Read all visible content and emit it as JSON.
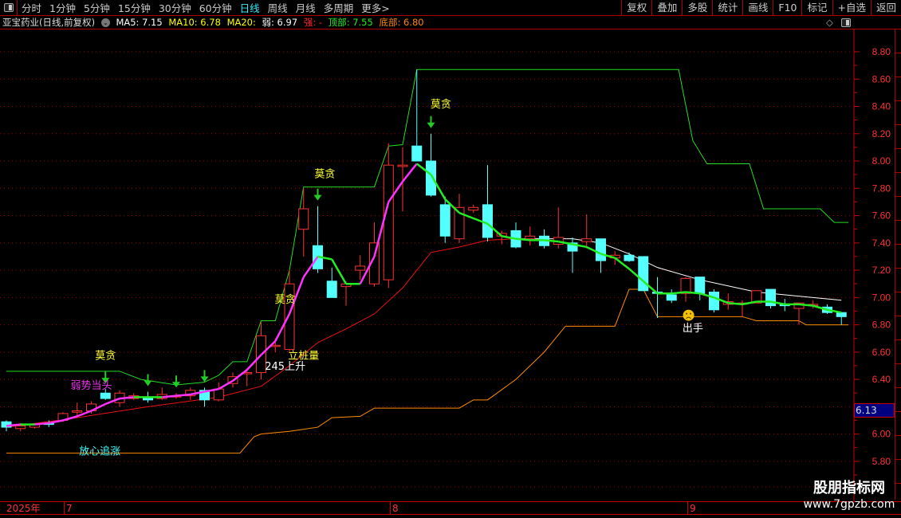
{
  "toolbar": {
    "timeframes": [
      "分时",
      "1分钟",
      "5分钟",
      "15分钟",
      "30分钟",
      "60分钟",
      "日线",
      "周线",
      "月线",
      "多周期",
      "更多>"
    ],
    "active": "日线",
    "right_buttons": [
      "复权",
      "叠加",
      "多股",
      "统计",
      "画线",
      "F10",
      "标记",
      "+自选",
      "返回"
    ]
  },
  "info": {
    "title": "亚宝药业(日线,前复权)",
    "ma5": "MA5: 7.15",
    "ma10": "MA10: 6.78",
    "ma20": "MA20:",
    "weak": "弱: 6.97",
    "strong": "强: -",
    "top": "顶部: 7.55",
    "bottom": "底部: 6.80"
  },
  "colors": {
    "up": "#ff3232",
    "down": "#54ffff",
    "upper": "#22dd22",
    "lower": "#ff8c00",
    "ma_up": "#ff33ff",
    "ma_down": "#22ee22",
    "ma_long": "#ee1111",
    "ma_white": "#ffffff",
    "grid": "#a00000",
    "axis": "#ff3333"
  },
  "axis": {
    "ticks": [
      "8.80",
      "8.60",
      "8.40",
      "8.20",
      "8.00",
      "7.80",
      "7.60",
      "7.40",
      "7.20",
      "7.00",
      "6.80",
      "6.60",
      "6.40",
      "6.20",
      "6.00",
      "5.80"
    ],
    "current_price": "6.13"
  },
  "dates": {
    "year": "2025年",
    "months": [
      "7",
      "8",
      "9"
    ]
  },
  "annotations": [
    {
      "text": "莫贪",
      "color": "#ffff33",
      "idx": 7,
      "price": 6.55
    },
    {
      "text": "莫贪",
      "color": "#ffff33",
      "idx": 22.5,
      "price": 7.88
    },
    {
      "text": "莫贪",
      "color": "#ffff33",
      "idx": 19.7,
      "price": 6.96
    },
    {
      "text": "莫贪",
      "color": "#ffff33",
      "idx": 30.7,
      "price": 8.39
    },
    {
      "text": "弱势当头",
      "color": "#ee33ee",
      "idx": 6,
      "price": 6.33
    },
    {
      "text": "放心追涨",
      "color": "#44ffff",
      "idx": 6.6,
      "price": 5.85
    },
    {
      "text": "立桩量",
      "color": "#ffff33",
      "idx": 21,
      "price": 6.55
    },
    {
      "text": "245上升",
      "color": "#ffffff",
      "idx": 19.7,
      "price": 6.47
    },
    {
      "text": "出手",
      "color": "#ffffff",
      "idx": 48.5,
      "price": 6.75
    }
  ],
  "logo": {
    "name": "股朋指标网",
    "url": "www.7gpzb.com"
  },
  "chart_data": {
    "type": "candlestick",
    "ylim": [
      5.75,
      8.95
    ],
    "candles": [
      [
        6.09,
        6.1,
        6.02,
        6.05
      ],
      [
        6.04,
        6.08,
        6.02,
        6.06
      ],
      [
        6.05,
        6.08,
        6.04,
        6.07
      ],
      [
        6.08,
        6.1,
        6.05,
        6.07
      ],
      [
        6.1,
        6.16,
        6.09,
        6.15
      ],
      [
        6.16,
        6.23,
        6.12,
        6.17
      ],
      [
        6.17,
        6.24,
        6.15,
        6.22
      ],
      [
        6.3,
        6.33,
        6.25,
        6.26
      ],
      [
        6.23,
        6.32,
        6.2,
        6.3
      ],
      [
        6.26,
        6.3,
        6.25,
        6.28
      ],
      [
        6.27,
        6.31,
        6.23,
        6.25
      ],
      [
        6.26,
        6.34,
        6.25,
        6.29
      ],
      [
        6.28,
        6.3,
        6.26,
        6.28
      ],
      [
        6.28,
        6.34,
        6.25,
        6.32
      ],
      [
        6.32,
        6.34,
        6.2,
        6.25
      ],
      [
        6.25,
        6.38,
        6.24,
        6.33
      ],
      [
        6.37,
        6.45,
        6.34,
        6.42
      ],
      [
        6.45,
        6.48,
        6.35,
        6.45
      ],
      [
        6.45,
        6.82,
        6.4,
        6.72
      ],
      [
        6.65,
        6.7,
        6.6,
        6.65
      ],
      [
        6.62,
        7.2,
        6.6,
        7.1
      ],
      [
        7.5,
        7.8,
        7.3,
        7.65
      ],
      [
        7.38,
        7.67,
        7.18,
        7.21
      ],
      [
        7.12,
        7.22,
        7.0,
        7.0
      ],
      [
        7.08,
        7.12,
        6.94,
        7.1
      ],
      [
        7.2,
        7.31,
        7.13,
        7.23
      ],
      [
        7.1,
        7.55,
        7.08,
        7.4
      ],
      [
        7.13,
        8.13,
        7.07,
        7.97
      ],
      [
        7.96,
        8.1,
        7.63,
        7.97
      ],
      [
        8.11,
        8.67,
        8.0,
        8.0
      ],
      [
        8.0,
        8.2,
        7.74,
        7.75
      ],
      [
        7.68,
        7.74,
        7.4,
        7.45
      ],
      [
        7.43,
        7.76,
        7.4,
        7.66
      ],
      [
        7.64,
        7.68,
        7.62,
        7.66
      ],
      [
        7.68,
        7.97,
        7.41,
        7.44
      ],
      [
        7.45,
        7.49,
        7.39,
        7.47
      ],
      [
        7.49,
        7.55,
        7.36,
        7.37
      ],
      [
        7.43,
        7.52,
        7.38,
        7.45
      ],
      [
        7.45,
        7.5,
        7.36,
        7.38
      ],
      [
        7.39,
        7.66,
        7.36,
        7.44
      ],
      [
        7.4,
        7.44,
        7.18,
        7.34
      ],
      [
        7.41,
        7.61,
        7.36,
        7.43
      ],
      [
        7.43,
        7.43,
        7.18,
        7.27
      ],
      [
        7.29,
        7.34,
        7.24,
        7.31
      ],
      [
        7.31,
        7.33,
        7.26,
        7.27
      ],
      [
        7.3,
        7.3,
        7.05,
        7.05
      ],
      [
        7.04,
        7.15,
        6.85,
        7.03
      ],
      [
        7.02,
        7.06,
        6.96,
        6.98
      ],
      [
        7.03,
        7.15,
        6.97,
        7.14
      ],
      [
        7.15,
        7.15,
        6.98,
        7.03
      ],
      [
        7.04,
        7.06,
        6.89,
        6.91
      ],
      [
        6.95,
        7.03,
        6.91,
        6.97
      ],
      [
        6.96,
        6.98,
        6.86,
        6.96
      ],
      [
        6.96,
        7.05,
        6.96,
        7.05
      ],
      [
        7.06,
        7.06,
        6.92,
        6.94
      ],
      [
        6.95,
        6.99,
        6.9,
        6.94
      ],
      [
        6.92,
        6.96,
        6.8,
        6.96
      ],
      [
        6.95,
        6.98,
        6.92,
        6.95
      ],
      [
        6.93,
        6.95,
        6.88,
        6.89
      ],
      [
        6.89,
        6.88,
        6.8,
        6.86
      ]
    ],
    "arrows": [
      7,
      10,
      12,
      14,
      22,
      30
    ],
    "upper_band": [
      [
        0,
        6.46
      ],
      [
        8,
        6.46
      ],
      [
        9.5,
        6.4
      ],
      [
        12,
        6.36
      ],
      [
        14,
        6.38
      ],
      [
        15,
        6.43
      ],
      [
        16,
        6.53
      ],
      [
        17,
        6.53
      ],
      [
        18,
        6.83
      ],
      [
        19,
        6.83
      ],
      [
        20,
        7.2
      ],
      [
        21,
        7.81
      ],
      [
        26,
        7.81
      ],
      [
        27,
        8.11
      ],
      [
        28,
        8.12
      ],
      [
        29,
        8.67
      ],
      [
        47.5,
        8.67
      ],
      [
        48.5,
        8.15
      ],
      [
        49.5,
        7.98
      ],
      [
        52.5,
        7.98
      ],
      [
        53.5,
        7.65
      ],
      [
        57.5,
        7.65
      ],
      [
        58.5,
        7.55
      ],
      [
        59.5,
        7.55
      ]
    ],
    "ma_main": [
      6.06,
      6.07,
      6.07,
      6.08,
      6.1,
      6.13,
      6.17,
      6.22,
      6.26,
      6.27,
      6.27,
      6.27,
      6.28,
      6.29,
      6.31,
      6.33,
      6.39,
      6.47,
      6.58,
      6.68,
      6.88,
      7.15,
      7.3,
      7.28,
      7.1,
      7.1,
      7.3,
      7.7,
      7.85,
      7.98,
      7.9,
      7.72,
      7.62,
      7.58,
      7.54,
      7.45,
      7.43,
      7.42,
      7.42,
      7.41,
      7.39,
      7.37,
      7.32,
      7.29,
      7.21,
      7.12,
      7.03,
      7.03,
      7.04,
      7.03,
      7.0,
      6.96,
      6.95,
      6.97,
      6.97,
      6.95,
      6.95,
      6.94,
      6.91,
      6.89
    ],
    "ma_long": [
      [
        0,
        6.05
      ],
      [
        5,
        6.12
      ],
      [
        10,
        6.2
      ],
      [
        15,
        6.27
      ],
      [
        18,
        6.35
      ],
      [
        20,
        6.5
      ],
      [
        22,
        6.67
      ],
      [
        24,
        6.77
      ],
      [
        26,
        6.88
      ],
      [
        28,
        7.07
      ],
      [
        30,
        7.33
      ],
      [
        32,
        7.37
      ],
      [
        34,
        7.42
      ],
      [
        36,
        7.43
      ]
    ],
    "ma_white": [
      [
        36,
        7.43
      ],
      [
        40,
        7.43
      ],
      [
        42,
        7.4
      ],
      [
        44,
        7.32
      ],
      [
        46,
        7.22
      ],
      [
        49,
        7.13
      ],
      [
        53,
        7.04
      ],
      [
        57,
        7.0
      ],
      [
        59,
        6.98
      ]
    ],
    "lower_band": [
      [
        0,
        5.86
      ],
      [
        16.5,
        5.86
      ],
      [
        17.5,
        5.98
      ],
      [
        18,
        6.0
      ],
      [
        20,
        6.02
      ],
      [
        22,
        6.05
      ],
      [
        23,
        6.12
      ],
      [
        25,
        6.13
      ],
      [
        26,
        6.19
      ],
      [
        32,
        6.19
      ],
      [
        33,
        6.25
      ],
      [
        34,
        6.25
      ],
      [
        36,
        6.4
      ],
      [
        38,
        6.6
      ],
      [
        39.5,
        6.79
      ],
      [
        43,
        6.79
      ],
      [
        44,
        7.06
      ],
      [
        45,
        7.06
      ],
      [
        46,
        6.86
      ],
      [
        52,
        6.86
      ],
      [
        53,
        6.83
      ],
      [
        56,
        6.83
      ],
      [
        56.5,
        6.8
      ],
      [
        59.5,
        6.8
      ]
    ]
  }
}
